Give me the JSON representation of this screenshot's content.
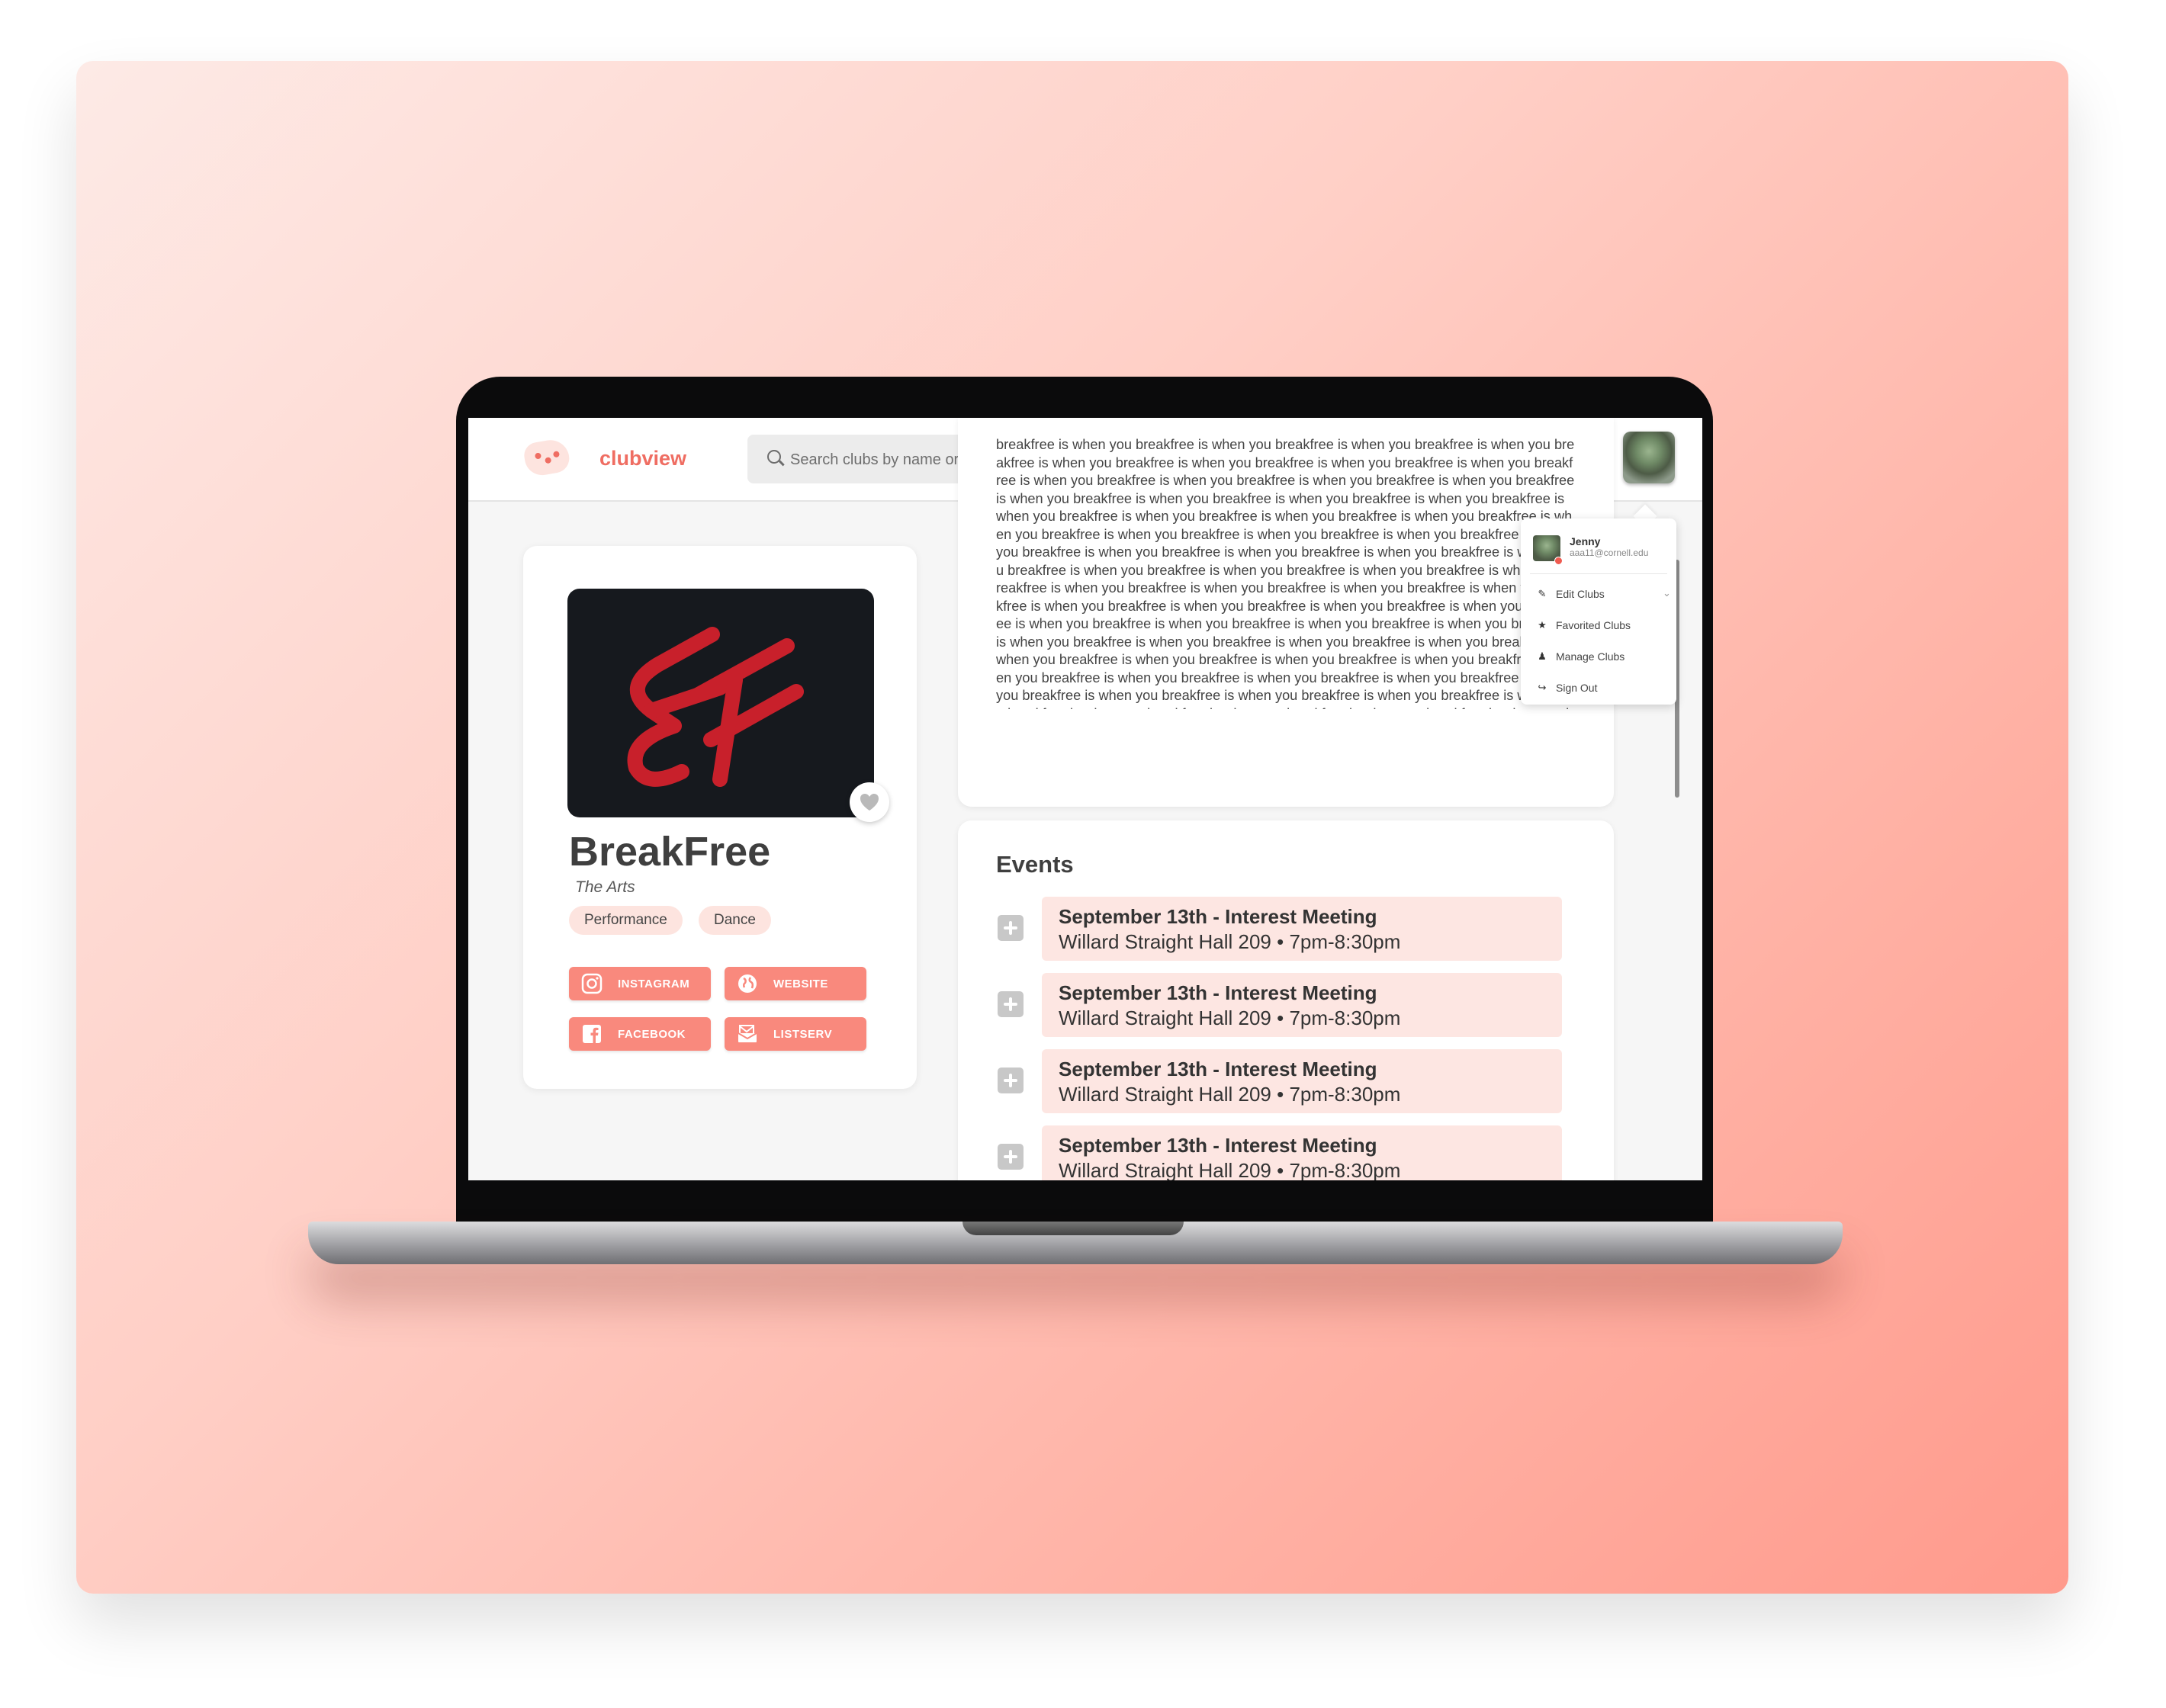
{
  "app": {
    "brand": "clubview",
    "search_placeholder": "Search clubs by name or category...",
    "colors": {
      "accent": "#f9897d",
      "tag_bg": "#fde4df",
      "event_bg": "#fde6e2"
    }
  },
  "club": {
    "name": "BreakFree",
    "category": "The Arts",
    "tags": [
      "Performance",
      "Dance"
    ],
    "links": [
      {
        "label": "INSTAGRAM",
        "icon": "instagram-icon"
      },
      {
        "label": "WEBSITE",
        "icon": "globe-icon"
      },
      {
        "label": "FACEBOOK",
        "icon": "facebook-icon"
      },
      {
        "label": "LISTSERV",
        "icon": "mail-list-icon"
      }
    ]
  },
  "description": {
    "text": "breakfree is when you breakfree is when you breakfree is when you breakfree is when you breakfree is when you breakfree is when you breakfree is when you breakfree is when you breakfree is when you breakfree is when you breakfree is when you breakfree is when you breakfree is when you breakfree is when you breakfree is when you breakfree is when you breakfree is when you breakfree is when you breakfree is when you breakfree is when you breakfree is when you breakfree is when you breakfree is when you breakfree is when you breakfree is when you breakfree is when you breakfree is when you breakfree is when you breakfree is when you breakfree is when you breakfree is when you breakfree is when you breakfree is when you breakfree is when you breakfree is when you breakfree is when you breakfree is when you breakfree is when you breakfree is when you breakfree is when you breakfree is when you breakfree is when you breakfree is when you breakfree is when you breakfree is when you breakfree is when you breakfree is when you breakfree is when you breakfree is when you breakfree is when you breakfree is when you breakfree is when you breakfree is when you breakfree is when you breakfree is when you breakfree is when you breakfree is when you breakfree is when you breakfree is when you breakfree is when you breakfree is when you breakfree is when you breakfree is when you breakfree is when you breakfree is when you breakfree is when you breakfree is when you breakfree is when you breakfree is when you breakfree is when you breakfree is when you breakfree is when you breakfree is when you breakfree is when you breakfree is when you breakfree is when you breakfree is when you breakfree is when you breakfree is when you breakfree is when you breakfree is when you breakfree is when you breakfree is when you breakfree is when you breakfree is when you breakfree is when you breakfree is when you breakfree is when you breakfree is when you breakfree is when you breakfree is when you"
  },
  "events": {
    "title": "Events",
    "items": [
      {
        "title": "September 13th - Interest Meeting",
        "meta": "Willard Straight Hall 209 • 7pm-8:30pm"
      },
      {
        "title": "September 13th - Interest Meeting",
        "meta": "Willard Straight Hall 209 • 7pm-8:30pm"
      },
      {
        "title": "September 13th - Interest Meeting",
        "meta": "Willard Straight Hall 209 • 7pm-8:30pm"
      },
      {
        "title": "September 13th - Interest Meeting",
        "meta": "Willard Straight Hall 209 • 7pm-8:30pm"
      }
    ]
  },
  "user_menu": {
    "name": "Jenny",
    "email": "aaa11@cornell.edu",
    "items": [
      {
        "label": "Edit Clubs",
        "icon": "pencil-icon"
      },
      {
        "label": "Favorited Clubs",
        "icon": "star-icon"
      },
      {
        "label": "Manage Clubs",
        "icon": "group-icon"
      },
      {
        "label": "Sign Out",
        "icon": "sign-out-icon"
      }
    ]
  }
}
